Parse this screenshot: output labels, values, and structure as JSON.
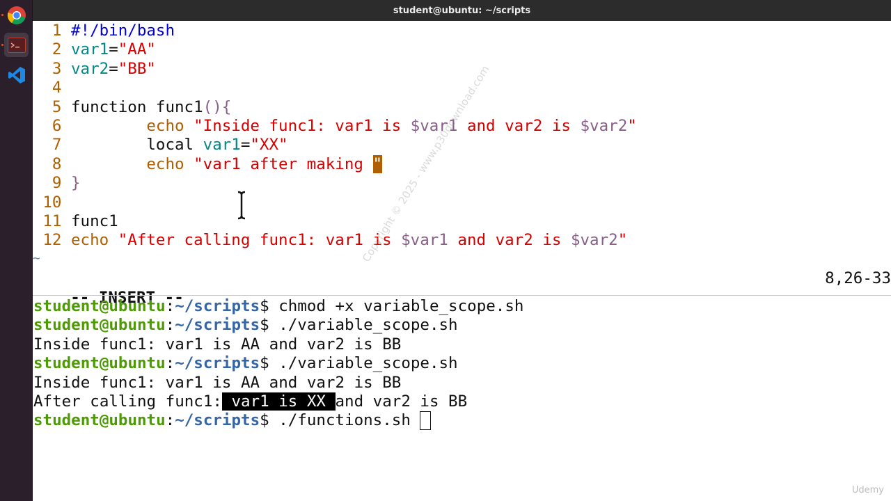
{
  "window": {
    "title": "student@ubuntu: ~/scripts"
  },
  "dock": {
    "items": [
      {
        "name": "chrome",
        "icon": "chrome-icon"
      },
      {
        "name": "terminal",
        "icon": "terminal-icon",
        "active": true
      },
      {
        "name": "vscode",
        "icon": "vscode-icon"
      }
    ]
  },
  "editor": {
    "lines": [
      {
        "num": "1",
        "parts": [
          {
            "t": "#!/bin/bash",
            "c": "comment"
          }
        ]
      },
      {
        "num": "2",
        "parts": [
          {
            "t": "var1",
            "c": "var"
          },
          {
            "t": "=",
            "c": ""
          },
          {
            "t": "\"AA\"",
            "c": "str"
          }
        ]
      },
      {
        "num": "3",
        "parts": [
          {
            "t": "var2",
            "c": "var"
          },
          {
            "t": "=",
            "c": ""
          },
          {
            "t": "\"BB\"",
            "c": "str"
          }
        ]
      },
      {
        "num": "4",
        "parts": []
      },
      {
        "num": "5",
        "parts": [
          {
            "t": "function func1",
            "c": ""
          },
          {
            "t": "(){",
            "c": "punc"
          }
        ]
      },
      {
        "num": "6",
        "parts": [
          {
            "t": "        echo ",
            "c": "kw"
          },
          {
            "t": "\"Inside func1: var1 is ",
            "c": "str"
          },
          {
            "t": "$var1",
            "c": "d"
          },
          {
            "t": " and var2 is ",
            "c": "str"
          },
          {
            "t": "$var2",
            "c": "d"
          },
          {
            "t": "\"",
            "c": "str"
          }
        ]
      },
      {
        "num": "7",
        "parts": [
          {
            "t": "        local ",
            "c": ""
          },
          {
            "t": "var1",
            "c": "var"
          },
          {
            "t": "=",
            "c": ""
          },
          {
            "t": "\"XX\"",
            "c": "str"
          }
        ]
      },
      {
        "num": "8",
        "parts": [
          {
            "t": "        echo ",
            "c": "kw"
          },
          {
            "t": "\"var1 after making ",
            "c": "str"
          },
          {
            "t": "\"",
            "c": "cursor"
          }
        ]
      },
      {
        "num": "9",
        "parts": [
          {
            "t": "}",
            "c": "punc"
          }
        ]
      },
      {
        "num": "10",
        "parts": []
      },
      {
        "num": "11",
        "parts": [
          {
            "t": "func1",
            "c": ""
          }
        ]
      },
      {
        "num": "12",
        "parts": [
          {
            "t": "echo ",
            "c": "kw"
          },
          {
            "t": "\"After calling func1: var1 is ",
            "c": "str"
          },
          {
            "t": "$var1",
            "c": "d"
          },
          {
            "t": " and var2 is ",
            "c": "str"
          },
          {
            "t": "$var2",
            "c": "d"
          },
          {
            "t": "\"",
            "c": "str"
          }
        ]
      }
    ],
    "tilde": "~",
    "mode": "-- INSERT --",
    "position": "8,26-33"
  },
  "terminal": {
    "prompt_user": "student@ubuntu",
    "prompt_sep": ":",
    "prompt_path": "~/scripts",
    "prompt_symbol": "$ ",
    "lines": [
      {
        "type": "cmd",
        "text": "chmod +x variable_scope.sh"
      },
      {
        "type": "cmd",
        "text": "./variable_scope.sh"
      },
      {
        "type": "out",
        "text": "Inside func1: var1 is AA and var2 is BB"
      },
      {
        "type": "cmd",
        "text": "./variable_scope.sh"
      },
      {
        "type": "out",
        "text": "Inside func1: var1 is AA and var2 is BB"
      },
      {
        "type": "out_hl",
        "before": "After calling func1:",
        "hl": " var1 is XX ",
        "after": "and var2 is BB"
      },
      {
        "type": "cmd",
        "text": "./functions.sh ",
        "cursor": true
      }
    ]
  },
  "watermark": "Copyright © 2025 - www.p30download.com",
  "brand": "Udemy",
  "colors": {
    "line_number": "#af5f00",
    "string": "#d70000",
    "variable": "#008787",
    "prompt_user": "#4e9a06",
    "prompt_path": "#3465a4"
  }
}
